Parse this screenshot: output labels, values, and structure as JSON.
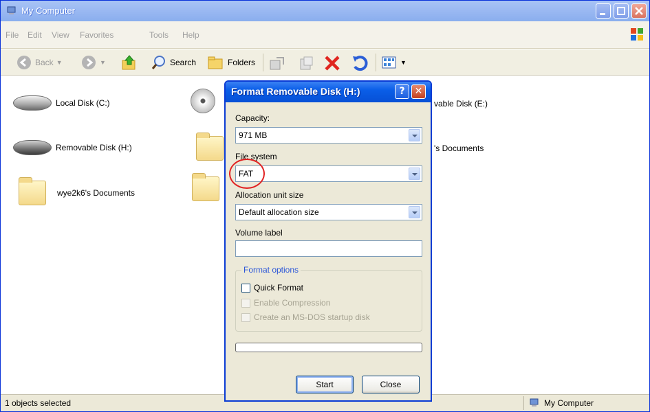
{
  "window": {
    "title": "My Computer"
  },
  "menubar": {
    "items": [
      "File",
      "Edit",
      "View",
      "Favorites",
      "Tools",
      "Help"
    ]
  },
  "toolbar": {
    "back_label": "Back",
    "search_label": "Search",
    "folders_label": "Folders"
  },
  "items": [
    {
      "label": "Local Disk (C:)"
    },
    {
      "label": "Removable Disk (H:)"
    },
    {
      "label": "wye2k6's Documents"
    },
    {
      "label": "vable Disk (E:)"
    },
    {
      "label": "'s Documents"
    }
  ],
  "dialog": {
    "title": "Format Removable Disk (H:)",
    "help": "?",
    "close": "✕",
    "capacity_label": "Capacity:",
    "capacity_value": "971 MB",
    "filesystem_label": "File system",
    "filesystem_value": "FAT",
    "allocation_label": "Allocation unit size",
    "allocation_value": "Default allocation size",
    "volume_label": "Volume label",
    "volume_value": "",
    "format_options_label": "Format options",
    "quick_format": "Quick Format",
    "enable_compression": "Enable Compression",
    "msdos_startup": "Create an MS-DOS startup disk",
    "start_button": "Start",
    "close_button": "Close"
  },
  "statusbar": {
    "left": "1 objects selected",
    "right": "My Computer"
  }
}
